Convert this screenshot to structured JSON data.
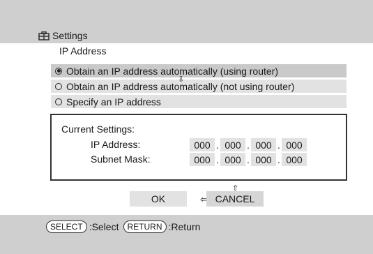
{
  "header": {
    "title": "Settings",
    "title_icon": "toolbox-icon"
  },
  "page": {
    "subtitle": "IP Address"
  },
  "options": [
    {
      "label": "Obtain an IP address automatically (using router)",
      "selected": true
    },
    {
      "label": "Obtain an IP address automatically (not using router)",
      "selected": false
    },
    {
      "label": "Specify an IP address",
      "selected": false
    }
  ],
  "current_settings": {
    "heading": "Current Settings:",
    "ip_label": "IP Address:",
    "ip": [
      "000",
      "000",
      "000",
      "000"
    ],
    "mask_label": "Subnet Mask:",
    "mask": [
      "000",
      "000",
      "000",
      "000"
    ]
  },
  "buttons": {
    "ok": "OK",
    "cancel": "CANCEL"
  },
  "footer": {
    "select_key": "SELECT",
    "select_text": ":Select",
    "return_key": "RETURN",
    "return_text": ":Return"
  }
}
